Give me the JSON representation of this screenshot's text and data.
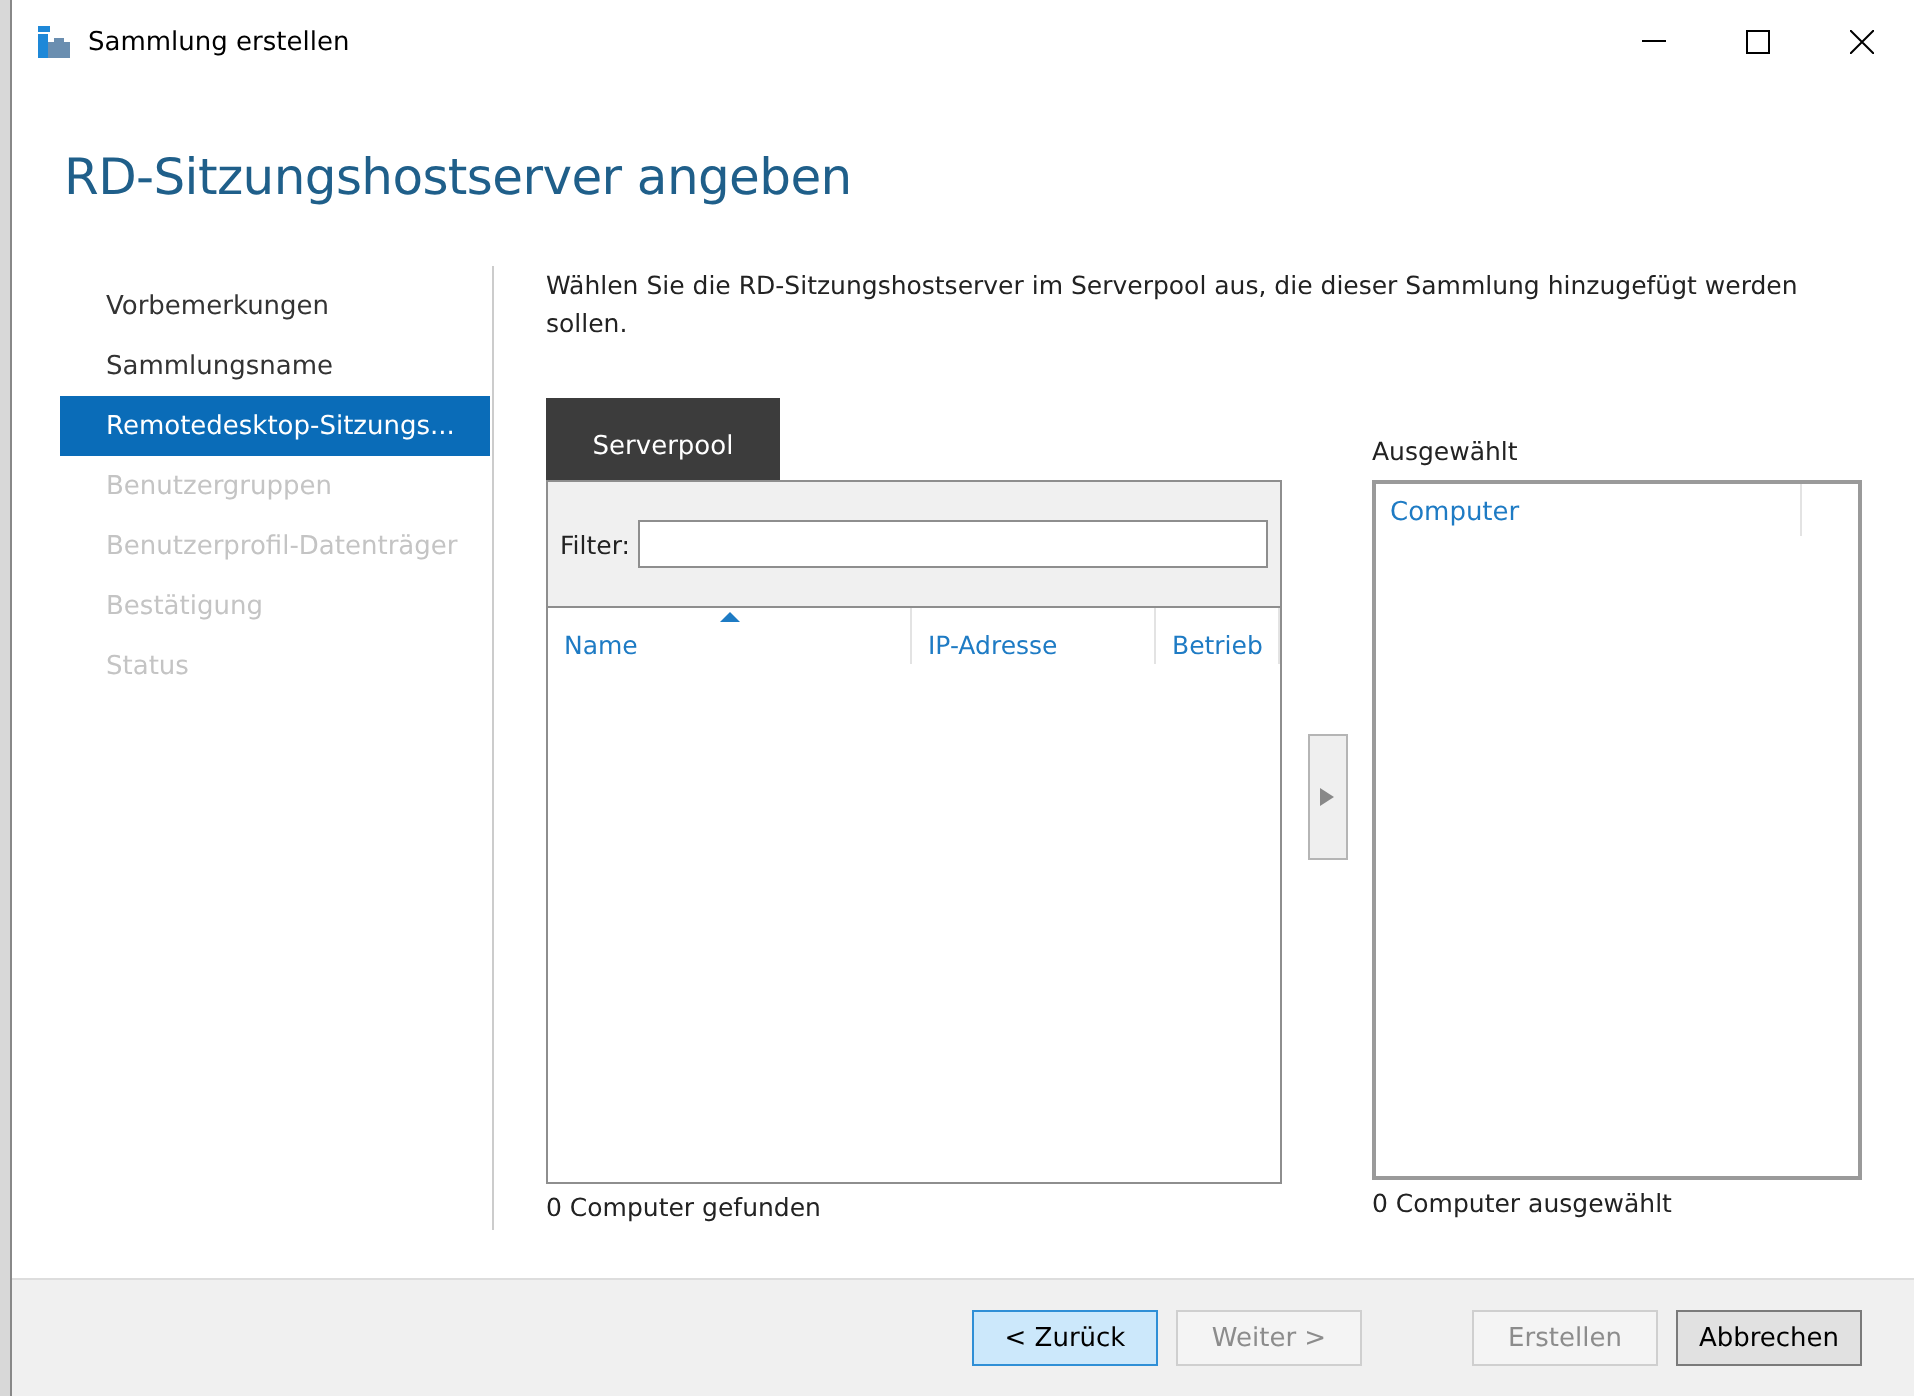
{
  "window": {
    "title": "Sammlung erstellen"
  },
  "heading": "RD-Sitzungshostserver angeben",
  "sidebar": {
    "items": [
      {
        "label": "Vorbemerkungen",
        "selected": false,
        "disabled": false
      },
      {
        "label": "Sammlungsname",
        "selected": false,
        "disabled": false
      },
      {
        "label": "Remotedesktop-Sitzungs...",
        "selected": true,
        "disabled": false
      },
      {
        "label": "Benutzergruppen",
        "selected": false,
        "disabled": true
      },
      {
        "label": "Benutzerprofil-Datenträger",
        "selected": false,
        "disabled": true
      },
      {
        "label": "Bestätigung",
        "selected": false,
        "disabled": true
      },
      {
        "label": "Status",
        "selected": false,
        "disabled": true
      }
    ]
  },
  "instruction": "Wählen Sie die RD-Sitzungshostserver im Serverpool aus, die dieser Sammlung hinzugefügt werden sollen.",
  "tabs": [
    {
      "label": "Serverpool",
      "selected": true
    }
  ],
  "filter": {
    "label": "Filter:"
  },
  "pool_table": {
    "columns": [
      {
        "label": "Name",
        "sorted": true
      },
      {
        "label": "IP-Adresse",
        "sorted": false
      },
      {
        "label": "Betrieb",
        "sorted": false
      }
    ]
  },
  "pool_count": "0 Computer gefunden",
  "selected_panel": {
    "label": "Ausgewählt",
    "columns": [
      "Computer"
    ],
    "count": "0 Computer ausgewählt"
  },
  "buttons": [
    {
      "label": "< Zurück",
      "focused": true,
      "disabled": false
    },
    {
      "label": "Weiter >",
      "focused": false,
      "disabled": true
    },
    {
      "label": "Erstellen",
      "focused": false,
      "disabled": true
    },
    {
      "label": "Abbrechen",
      "focused": false,
      "disabled": false
    }
  ]
}
